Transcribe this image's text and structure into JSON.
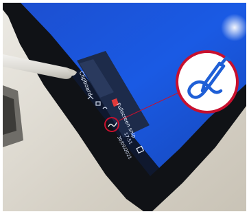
{
  "photo": {
    "subject": "tablet-taskbar-with-pen-icon",
    "colors": {
      "screen": "#1a54d6",
      "bezel": "#101216",
      "table": "#d7d2c8",
      "pen": "#e6e4df",
      "callout_ring": "#c8102e",
      "callout_fill": "#ffffff",
      "pen_icon": "#1f5fd6"
    },
    "icons": {
      "callout": "pen-pairing-icon",
      "tray_small": "pen-icon",
      "tray_notifications": "notifications-icon"
    }
  },
  "screen_text": {
    "clipboard_label": "Clipboard",
    "fullscreen_label": "Fullscreen snip",
    "time": "17:51",
    "date": "30/09/2021",
    "more_label": "..."
  }
}
